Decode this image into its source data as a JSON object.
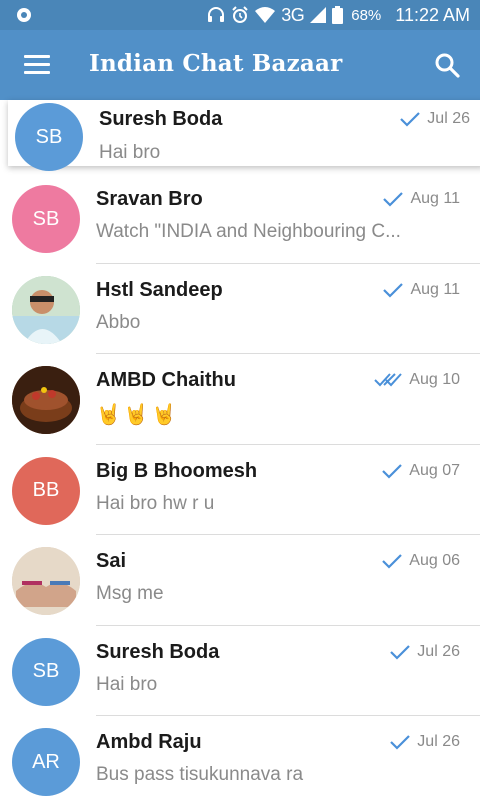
{
  "status_bar": {
    "network": "3G",
    "battery_percent": "68%",
    "time": "11:22 AM"
  },
  "toolbar": {
    "title": "Indian Chat Bazaar"
  },
  "colors": {
    "status_bar_bg": "#4a86b8",
    "toolbar_bg": "#5190c8",
    "check_blue": "#4a90d9"
  },
  "chats": [
    {
      "initials": "SB",
      "name": "Suresh Boda",
      "message": "Hai bro",
      "date": "Jul 26",
      "avatar_color": "#5b9bd8"
    },
    {
      "initials": "SB",
      "name": "Sravan Bro",
      "message": "Watch \"INDIA  and Neighbouring C...",
      "date": "Aug 11",
      "avatar_color": "#ee7aa0"
    },
    {
      "initials": "",
      "name": "Hstl Sandeep",
      "message": "Abbo",
      "date": "Aug 11",
      "avatar_color": "#9cc5a8"
    },
    {
      "initials": "",
      "name": "AMBD Chaithu",
      "message": "🤘🤘🤘",
      "date": "Aug 10",
      "avatar_color": "#6b3a1e"
    },
    {
      "initials": "BB",
      "name": "Big B Bhoomesh",
      "message": "Hai bro hw r u",
      "date": "Aug 07",
      "avatar_color": "#e0685a"
    },
    {
      "initials": "",
      "name": "Sai",
      "message": "Msg me",
      "date": "Aug 06",
      "avatar_color": "#d9c7b5"
    },
    {
      "initials": "SB",
      "name": "Suresh Boda",
      "message": "Hai bro",
      "date": "Jul 26",
      "avatar_color": "#5b9bd8"
    },
    {
      "initials": "AR",
      "name": "Ambd Raju",
      "message": "Bus pass tisukunnava ra",
      "date": "Jul 26",
      "avatar_color": "#5b9bd8"
    }
  ]
}
